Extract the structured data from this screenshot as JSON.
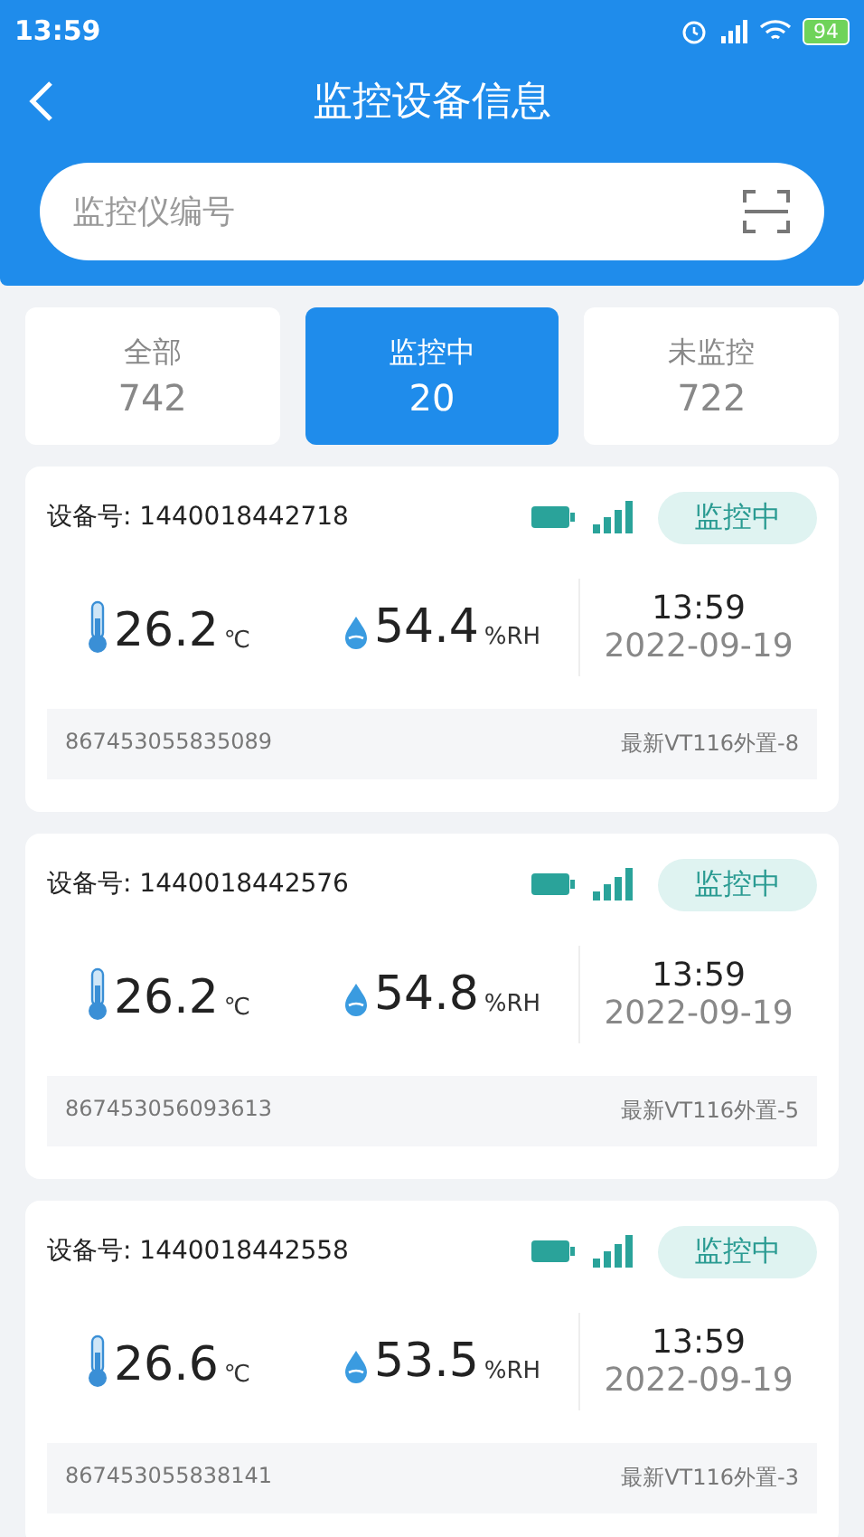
{
  "status_bar": {
    "time": "13:59",
    "battery": "94"
  },
  "header": {
    "title": "监控设备信息"
  },
  "search": {
    "placeholder": "监控仪编号"
  },
  "tabs": [
    {
      "label": "全部",
      "count": "742",
      "selected": false
    },
    {
      "label": "监控中",
      "count": "20",
      "selected": true
    },
    {
      "label": "未监控",
      "count": "722",
      "selected": false
    }
  ],
  "devices": [
    {
      "device_label": "设备号: 1440018442718",
      "status": "监控中",
      "temperature": "26.2",
      "temp_unit": "℃",
      "humidity": "54.4",
      "humidity_unit": "%RH",
      "time": "13:59",
      "date": "2022-09-19",
      "serial": "867453055835089",
      "model": "最新VT116外置-8"
    },
    {
      "device_label": "设备号: 1440018442576",
      "status": "监控中",
      "temperature": "26.2",
      "temp_unit": "℃",
      "humidity": "54.8",
      "humidity_unit": "%RH",
      "time": "13:59",
      "date": "2022-09-19",
      "serial": "867453056093613",
      "model": "最新VT116外置-5"
    },
    {
      "device_label": "设备号: 1440018442558",
      "status": "监控中",
      "temperature": "26.6",
      "temp_unit": "℃",
      "humidity": "53.5",
      "humidity_unit": "%RH",
      "time": "13:59",
      "date": "2022-09-19",
      "serial": "867453055838141",
      "model": "最新VT116外置-3"
    }
  ]
}
